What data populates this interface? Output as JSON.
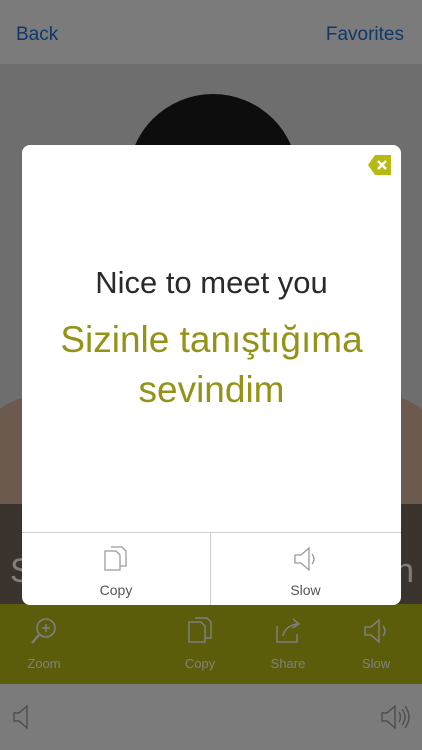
{
  "navbar": {
    "back_label": "Back",
    "favorites_label": "Favorites"
  },
  "photo": {
    "caption_left": "S",
    "caption_right": "n"
  },
  "toolbar": {
    "items": [
      {
        "label": "Zoom",
        "icon": "zoom-icon"
      },
      {
        "label": "Copy",
        "icon": "copy-icon"
      },
      {
        "label": "Share",
        "icon": "share-icon"
      },
      {
        "label": "Slow",
        "icon": "speaker-icon"
      }
    ]
  },
  "modal": {
    "english": "Nice to meet you",
    "turkish": "Sizinle tanıştığıma sevindim",
    "actions": [
      {
        "label": "Copy",
        "icon": "copy-icon"
      },
      {
        "label": "Slow",
        "icon": "speaker-icon"
      }
    ]
  },
  "colors": {
    "accent": "#b8ba14",
    "link": "#1f6fd6",
    "translation": "#949317"
  }
}
